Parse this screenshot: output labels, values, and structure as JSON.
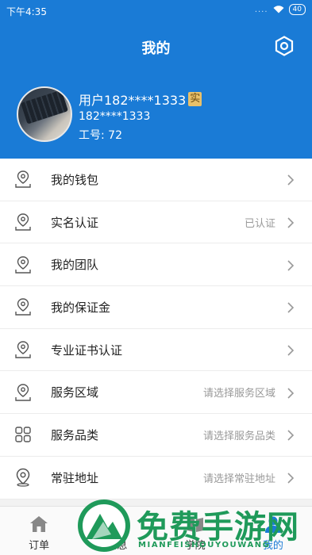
{
  "status_bar": {
    "time": "下午4:35",
    "signal": "....",
    "battery": "40"
  },
  "header": {
    "title": "我的"
  },
  "user": {
    "name": "用户182****1333",
    "badge": "实",
    "phone": "182****1333",
    "id_label": "工号: 72"
  },
  "menu": {
    "items": [
      {
        "label": "我的钱包",
        "value": "",
        "icon": "location-pin-icon"
      },
      {
        "label": "实名认证",
        "value": "已认证",
        "icon": "location-pin-icon"
      },
      {
        "label": "我的团队",
        "value": "",
        "icon": "location-pin-icon"
      },
      {
        "label": "我的保证金",
        "value": "",
        "icon": "location-pin-icon"
      },
      {
        "label": "专业证书认证",
        "value": "",
        "icon": "location-pin-icon"
      },
      {
        "label": "服务区域",
        "value": "请选择服务区域",
        "icon": "location-pin-icon"
      },
      {
        "label": "服务品类",
        "value": "请选择服务品类",
        "icon": "grid-icon"
      },
      {
        "label": "常驻地址",
        "value": "请选择常驻地址",
        "icon": "map-pin-icon"
      }
    ]
  },
  "tabbar": {
    "tabs": [
      {
        "label": "订单",
        "icon": "home-icon",
        "active": false
      },
      {
        "label": "消息",
        "icon": "message-icon",
        "active": false
      },
      {
        "label": "学院",
        "icon": "book-icon",
        "active": false
      },
      {
        "label": "我的",
        "icon": "user-icon",
        "active": true
      }
    ]
  },
  "watermark": {
    "title": "免费手游网",
    "subtitle": "MIANFEISHOUYOUWANG"
  },
  "colors": {
    "primary": "#1a7bd6",
    "watermark": "#1f9a5a"
  }
}
